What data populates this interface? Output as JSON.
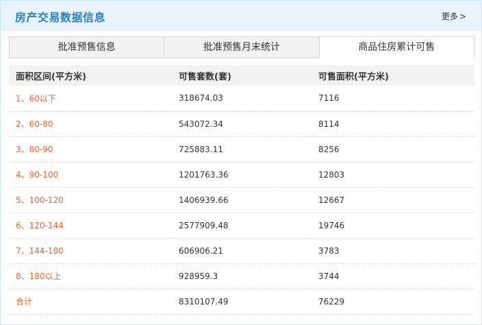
{
  "header": {
    "title": "房产交易数据信息",
    "more_label": "更多",
    "more_arrow": ">"
  },
  "tabs": [
    {
      "label": "批准预售信息",
      "active": false
    },
    {
      "label": "批准预售月末统计",
      "active": false
    },
    {
      "label": "商品住房累计可售",
      "active": true
    }
  ],
  "table": {
    "headers": [
      "面积区间(平方米)",
      "可售套数(套)",
      "可售面积(平方米)"
    ],
    "rows": [
      [
        "1、60以下",
        "318674.03",
        "7116"
      ],
      [
        "2、60-80",
        "543072.34",
        "8114"
      ],
      [
        "3、80-90",
        "725883.11",
        "8256"
      ],
      [
        "4、90-100",
        "1201763.36",
        "12803"
      ],
      [
        "5、100-120",
        "1406939.66",
        "12667"
      ],
      [
        "6、120-144",
        "2577909.48",
        "19746"
      ],
      [
        "7、144-180",
        "606906.21",
        "3783"
      ],
      [
        "8、180以上",
        "928959.3",
        "3744"
      ],
      [
        "合计",
        "8310107.49",
        "76229"
      ]
    ]
  },
  "colors": {
    "title_blue": "#2a7fc0",
    "range_orange": "#e8622d",
    "header_bg": "#e8f3fb"
  }
}
